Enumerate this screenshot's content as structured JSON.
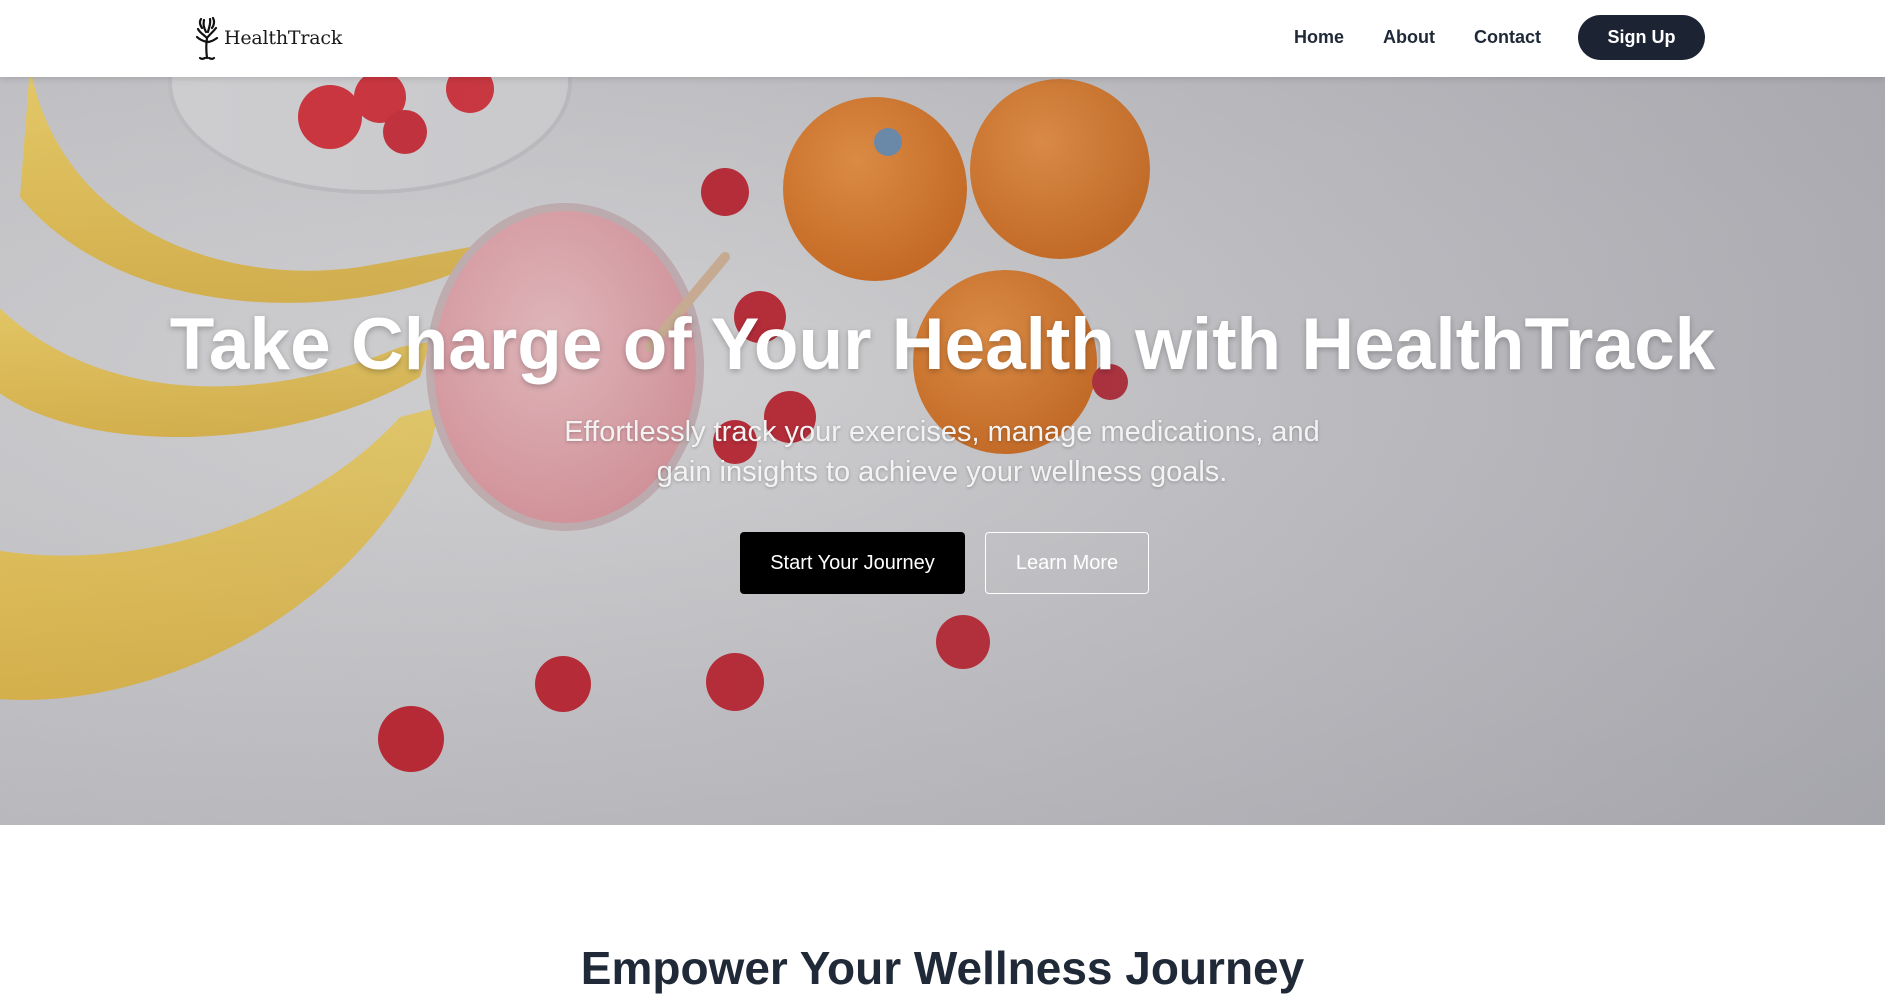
{
  "header": {
    "brand": "HealthTrack",
    "logo_icon": "tree-logo-icon",
    "nav": [
      {
        "label": "Home"
      },
      {
        "label": "About"
      },
      {
        "label": "Contact"
      }
    ],
    "signup_label": "Sign Up"
  },
  "hero": {
    "title": "Take Charge of Your Health with HealthTrack",
    "subtitle": "Effortlessly track your exercises, manage medications, and gain insights to achieve your wellness goals.",
    "primary_button": "Start Your Journey",
    "secondary_button": "Learn More",
    "background": "fruit-smoothie-photo"
  },
  "section": {
    "title": "Empower Your Wellness Journey"
  },
  "colors": {
    "primary": "#1c2434",
    "button_dark": "#000000",
    "text_dark": "#1f2937"
  }
}
